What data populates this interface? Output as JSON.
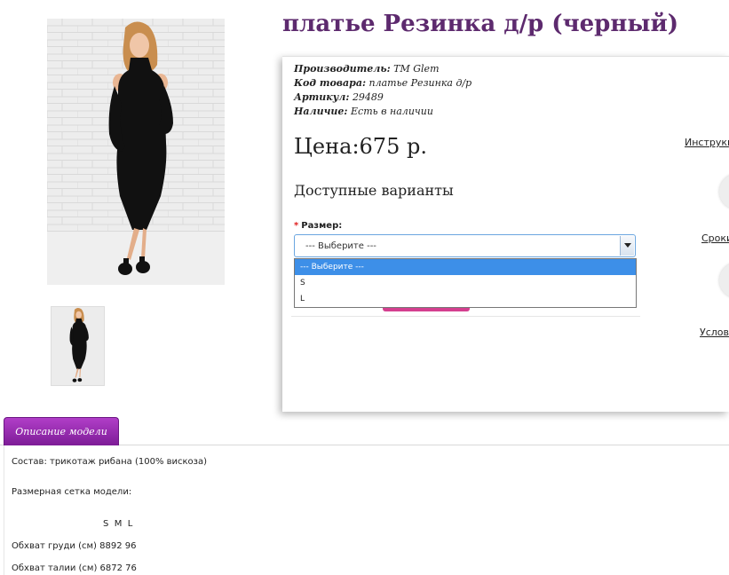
{
  "product": {
    "title": "платье Резинка д/р (черный)",
    "info": [
      {
        "label": "Производитель:",
        "value": "TM Glem"
      },
      {
        "label": "Код товара:",
        "value": "платье Резинка д/р"
      },
      {
        "label": "Артикул:",
        "value": "29489"
      },
      {
        "label": "Наличие:",
        "value": "Есть в наличии"
      }
    ],
    "price": "Цена:675 р."
  },
  "options": {
    "title": "Доступные варианты",
    "required_mark": "*",
    "size_label": "Размер:",
    "size_selected": "--- Выберите ---",
    "size_options": [
      "--- Выберите ---",
      "S",
      "L"
    ]
  },
  "side_links": {
    "instructions": "Инструкц",
    "terms": "Сроки",
    "conditions": "Услові"
  },
  "tabs": {
    "description": "Описание модели"
  },
  "description": {
    "composition": "Состав: трикотаж рибана (100% вискоза)",
    "size_chart_title": "Размерная сетка модели:",
    "size_header": "S  M  L",
    "chest": "Обхват груди (см) 8892 96",
    "waist": "Обхват талии (см) 6872 76"
  },
  "colors": {
    "title": "#5d2a6e",
    "tab_bg": "#9b2db6",
    "dropdown_highlight": "#3d8fe8",
    "required": "#e02020"
  }
}
